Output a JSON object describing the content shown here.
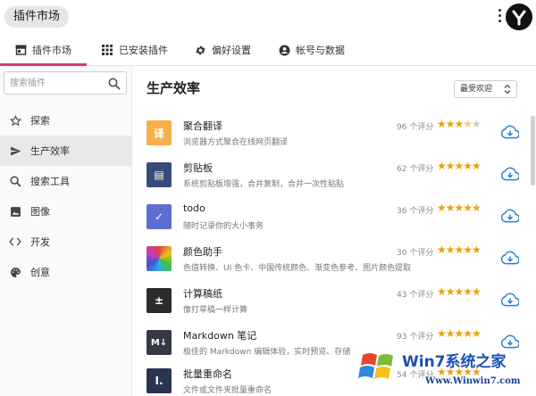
{
  "app": {
    "title": "插件市场"
  },
  "tabs": [
    {
      "label": "插件市场",
      "icon": "store-icon",
      "active": true
    },
    {
      "label": "已安装插件",
      "icon": "grid-icon",
      "active": false
    },
    {
      "label": "偏好设置",
      "icon": "gear-icon",
      "active": false
    },
    {
      "label": "帐号与数据",
      "icon": "account-icon",
      "active": false
    }
  ],
  "search": {
    "placeholder": "搜索插件"
  },
  "sidebar": {
    "items": [
      {
        "label": "探索",
        "icon": "star-outline-icon",
        "active": false
      },
      {
        "label": "生产效率",
        "icon": "send-icon",
        "active": true
      },
      {
        "label": "搜索工具",
        "icon": "search-icon",
        "active": false
      },
      {
        "label": "图像",
        "icon": "image-icon",
        "active": false
      },
      {
        "label": "开发",
        "icon": "code-icon",
        "active": false
      },
      {
        "label": "创意",
        "icon": "palette-icon",
        "active": false
      }
    ]
  },
  "main": {
    "section_title": "生产效率",
    "sort_label": "最受欢迎"
  },
  "plugins": [
    {
      "name": "聚合翻译",
      "desc": "浏览器方式聚合在线网页翻译",
      "rating": "96 个评分",
      "stars": 3.5,
      "icon_color": "#f6b04a",
      "icon_glyph": "译"
    },
    {
      "name": "剪贴板",
      "desc": "系统剪贴板增强，合并复制，合并一次性粘贴",
      "rating": "62 个评分",
      "stars": 5,
      "icon_color": "#3a4a7a",
      "icon_glyph": "▤"
    },
    {
      "name": "todo",
      "desc": "随时记录你的大小事务",
      "rating": "36 个评分",
      "stars": 5,
      "icon_color": "#5b6fd3",
      "icon_glyph": "✓"
    },
    {
      "name": "颜色助手",
      "desc": "色值转换、UI 色卡、中国传统颜色、渐变色参考、图片颜色提取",
      "rating": "30 个评分",
      "stars": 5,
      "icon_color": "#e04040",
      "icon_glyph": ""
    },
    {
      "name": "计算稿纸",
      "desc": "像打草稿一样计算",
      "rating": "43 个评分",
      "stars": 5,
      "icon_color": "#2b2b2b",
      "icon_glyph": "±"
    },
    {
      "name": "Markdown 笔记",
      "desc": "极佳的 Markdown 编辑体验，实时预览、存储",
      "rating": "93 个评分",
      "stars": 5,
      "icon_color": "#333a44",
      "icon_glyph": "M↓"
    },
    {
      "name": "批量重命名",
      "desc": "文件或文件夹批量重命名",
      "rating": "54 个评分",
      "stars": 5,
      "icon_color": "#2a3550",
      "icon_glyph": "I."
    }
  ],
  "colors": {
    "accent": "#d63b6e",
    "star": "#f0a000",
    "download": "#2a7fd4"
  },
  "watermark": {
    "brand": "Win7系统之家",
    "url": "Www.Winwin7.com"
  }
}
